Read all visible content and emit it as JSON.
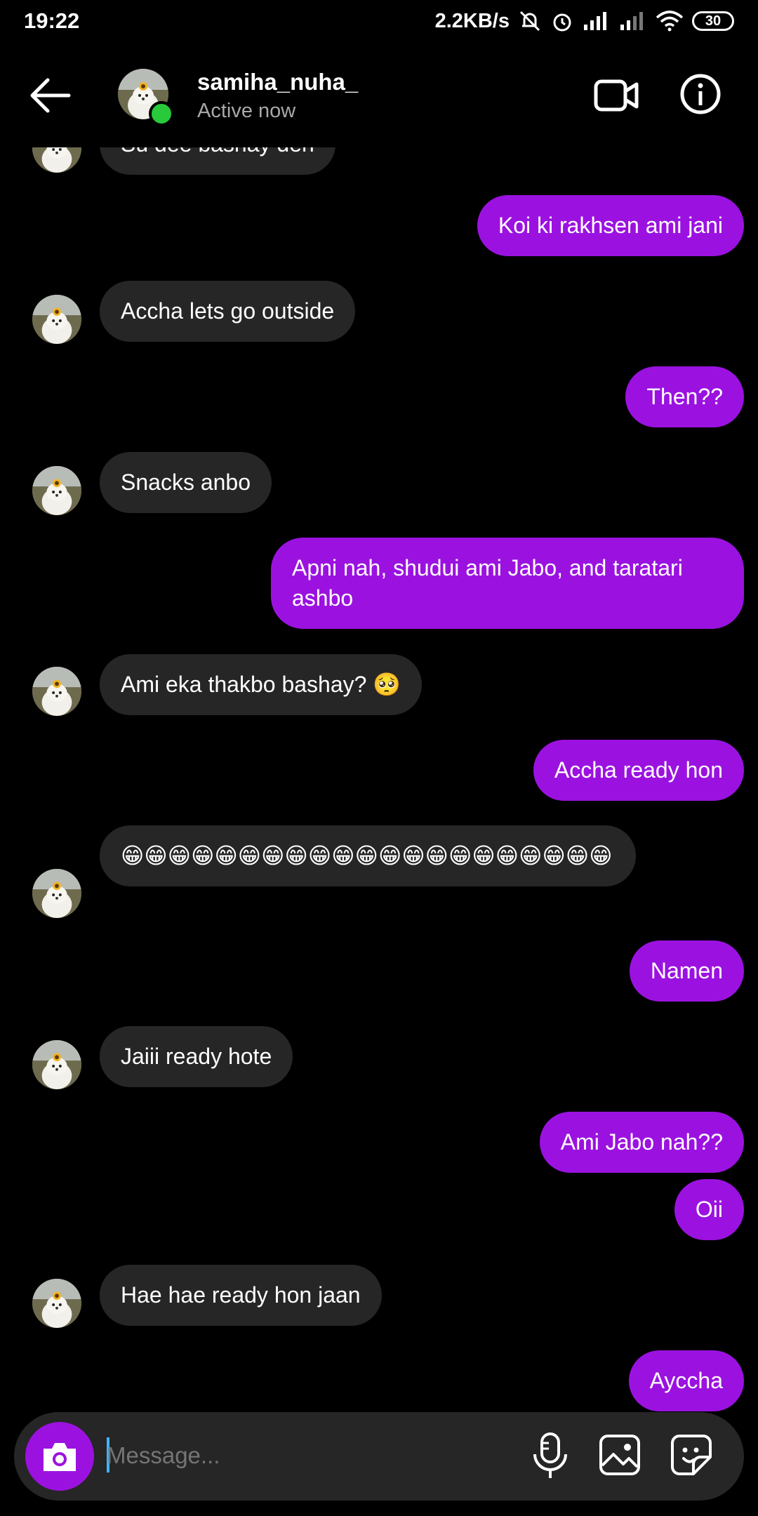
{
  "status_bar": {
    "time": "19:22",
    "speed": "2.2KB/s",
    "battery": "30"
  },
  "header": {
    "username": "samiha_nuha_",
    "status": "Active now",
    "icons": [
      "back-arrow-icon",
      "video-call-icon",
      "info-icon"
    ]
  },
  "messages": [
    {
      "from": "them",
      "text": "Su dee bashay den"
    },
    {
      "from": "me",
      "text": "Koi ki rakhsen ami jani"
    },
    {
      "from": "them",
      "text": "Accha lets go outside"
    },
    {
      "from": "me",
      "text": "Then??"
    },
    {
      "from": "them",
      "text": "Snacks anbo"
    },
    {
      "from": "me",
      "text": "Apni nah, shudui ami Jabo, and taratari ashbo"
    },
    {
      "from": "them",
      "text": "Ami eka thakbo bashay? 🥺"
    },
    {
      "from": "me",
      "text": "Accha ready hon"
    },
    {
      "from": "them",
      "text": "😁😁😁😁😁😁😁😁😁😁😁😁😁😁😁😁😁😁😁😁😁"
    },
    {
      "from": "me",
      "text": "Namen"
    },
    {
      "from": "them",
      "text": "Jaiii ready hote"
    },
    {
      "from": "me",
      "text": "Ami Jabo nah??"
    },
    {
      "from": "me",
      "text": "Oii"
    },
    {
      "from": "them",
      "text": "Hae hae ready hon jaan"
    },
    {
      "from": "me",
      "text": "Ayccha"
    }
  ],
  "composer": {
    "placeholder": "Message...",
    "icons": [
      "camera-icon",
      "microphone-icon",
      "gallery-icon",
      "sticker-icon"
    ]
  },
  "colors": {
    "outgoing_bubble": "#9b12e0",
    "incoming_bubble": "#262626",
    "online": "#28c93a",
    "background": "#000000"
  }
}
